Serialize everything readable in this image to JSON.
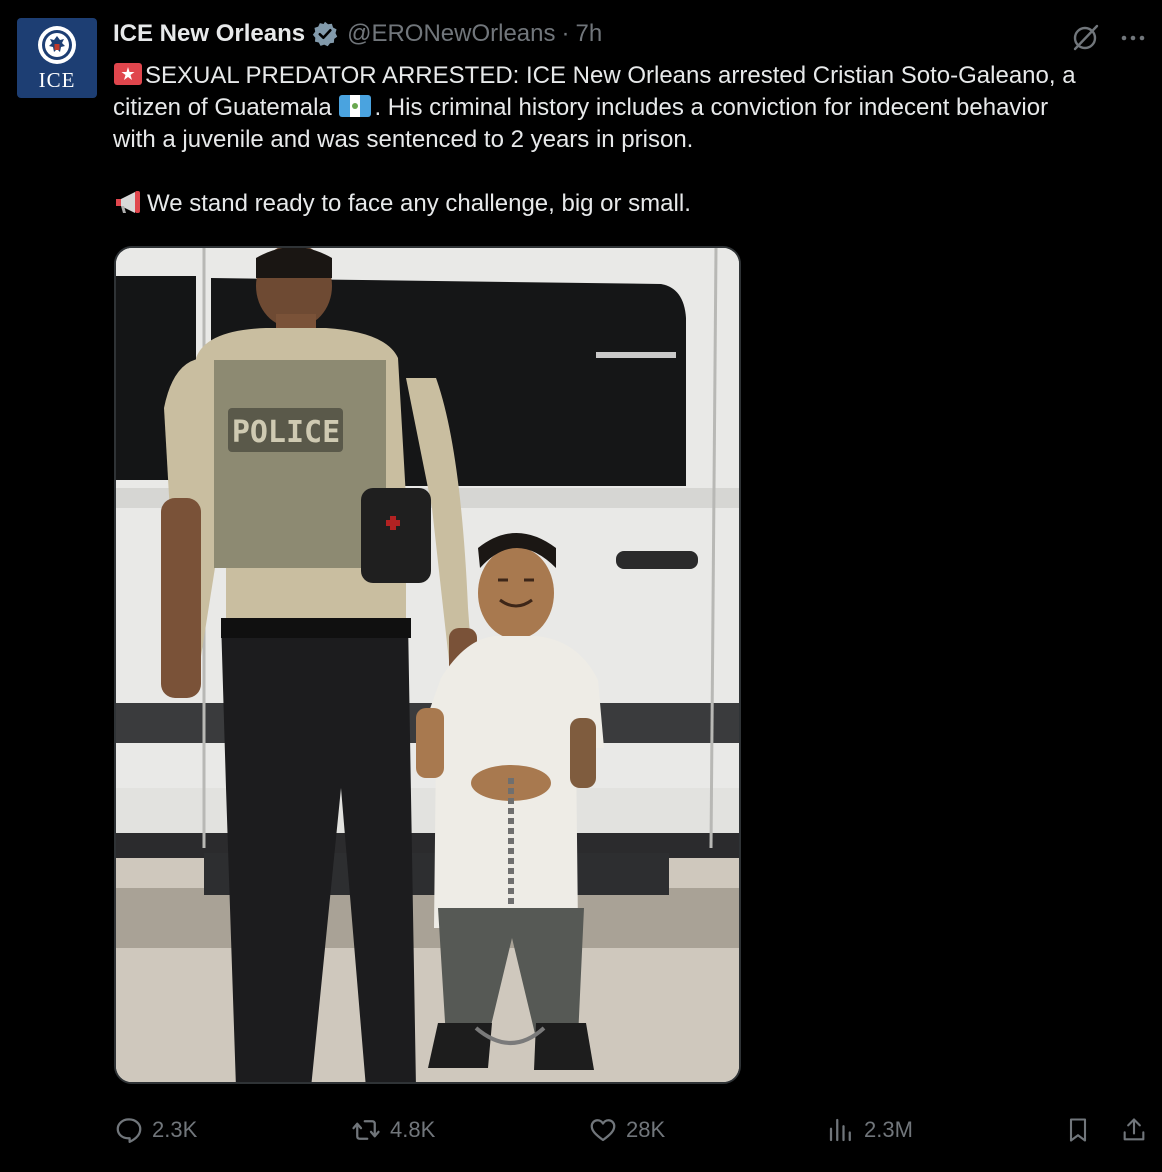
{
  "account": {
    "display_name": "ICE New Orleans",
    "handle": "@ERONewOrleans",
    "separator": "·",
    "time": "7h",
    "avatar_text": "ICE",
    "verified": true
  },
  "tweet": {
    "line1_rest": "SEXUAL PREDATOR ARRESTED: ICE New Orleans arrested Cristian Soto-Galeano, a",
    "line2_a": "citizen of Guatemala",
    "line2_b": ". His criminal history includes a conviction for indecent behavior",
    "line3": "with a juvenile and was sentenced to 2 years in prison.",
    "line4_rest": "We stand ready to face any challenge, big or small.",
    "vest_patch": "POLICE"
  },
  "stats": {
    "replies": "2.3K",
    "reposts": "4.8K",
    "likes": "28K",
    "views": "2.3M"
  },
  "icons": {
    "avatar": "dhs-seal-icon",
    "verified": "verified-badge-icon",
    "grok": "grok-icon",
    "more": "more-icon",
    "reply": "reply-icon",
    "repost": "repost-icon",
    "like": "heart-icon",
    "views": "views-icon",
    "bookmark": "bookmark-icon",
    "share": "share-icon"
  },
  "colors": {
    "background": "#000000",
    "text": "#e7e9ea",
    "muted": "#71767b",
    "avatar_bg": "#1d3e73"
  }
}
